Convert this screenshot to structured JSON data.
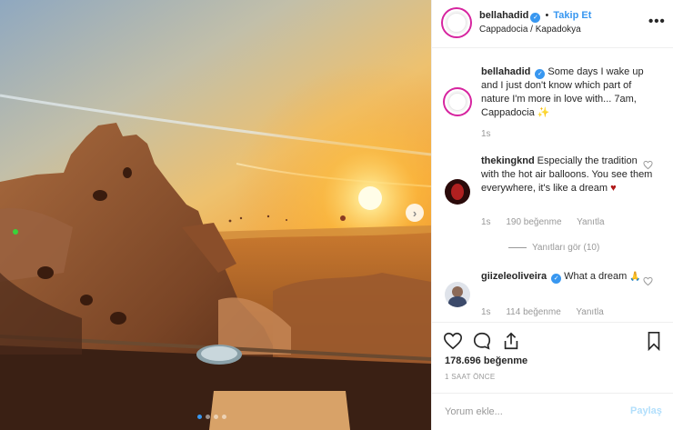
{
  "header": {
    "username": "bellahadid",
    "separator": "•",
    "follow_label": "Takip Et",
    "location": "Cappadocia / Kapadokya",
    "more_icon": "more-horizontal-icon"
  },
  "caption": {
    "username": "bellahadid",
    "text": "Some days I wake up and I just don't know which part of nature I'm more in love with... 7am, Cappadocia",
    "emoji": "✨",
    "time": "1s"
  },
  "comments": [
    {
      "username": "thekingknd",
      "text": "Especially the tradition with the hot air balloons. You see them everywhere, it's like a dream",
      "emoji": "♥",
      "time": "1s",
      "likes": "190 beğenme",
      "reply_label": "Yanıtla",
      "view_replies": "Yanıtları gör (10)"
    },
    {
      "username": "giizeleoliveira",
      "text": "What a dream",
      "emoji": "🙏",
      "time": "1s",
      "likes": "114 beğenme",
      "reply_label": "Yanıtla"
    }
  ],
  "actions": {
    "likes_count": "178.696 beğenme",
    "posted_ago": "1 SAAT ÖNCE"
  },
  "add_comment": {
    "placeholder": "Yorum ekle...",
    "post_label": "Paylaş"
  },
  "carousel": {
    "next_icon": "chevron-right-icon",
    "slide_count": 4,
    "active_slide": 1
  },
  "colors": {
    "accent": "#3897f0",
    "heart": "#ed4956",
    "muted": "#999999"
  }
}
